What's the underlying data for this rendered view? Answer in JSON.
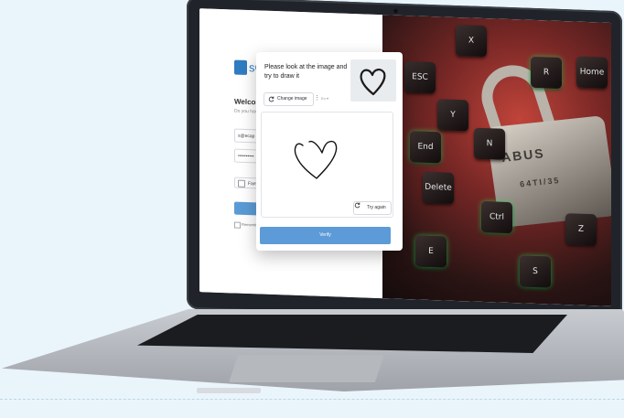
{
  "login": {
    "logo_text": "sC",
    "welcome": "Welcom",
    "subtitle": "Do you have",
    "email_value": "s@ecap",
    "password_value": "••••••••••",
    "checkbox_label": "Fam",
    "remember_label": "Remember"
  },
  "captcha": {
    "prompt": "Please look at the image and try to draw it",
    "change_image_label": "Change image",
    "menu_glyph": "⋮",
    "language": "En ▾",
    "try_again_label": "Try again",
    "verify_label": "Verify",
    "reference_shape": "heart-icon",
    "drawn_shape": "heart"
  },
  "photo": {
    "keys": [
      "X",
      "ESC",
      "R",
      "Home",
      "End",
      "Delete",
      "Ctrl",
      "Z",
      "E",
      "N",
      "Y",
      "S"
    ],
    "brand": "ABUS",
    "serial": "64TI/35",
    "accent": "#c0443a",
    "glow": "#28dc5a"
  },
  "colors": {
    "primary_button": "#5d9bd8",
    "background": "#eaf5fb"
  }
}
